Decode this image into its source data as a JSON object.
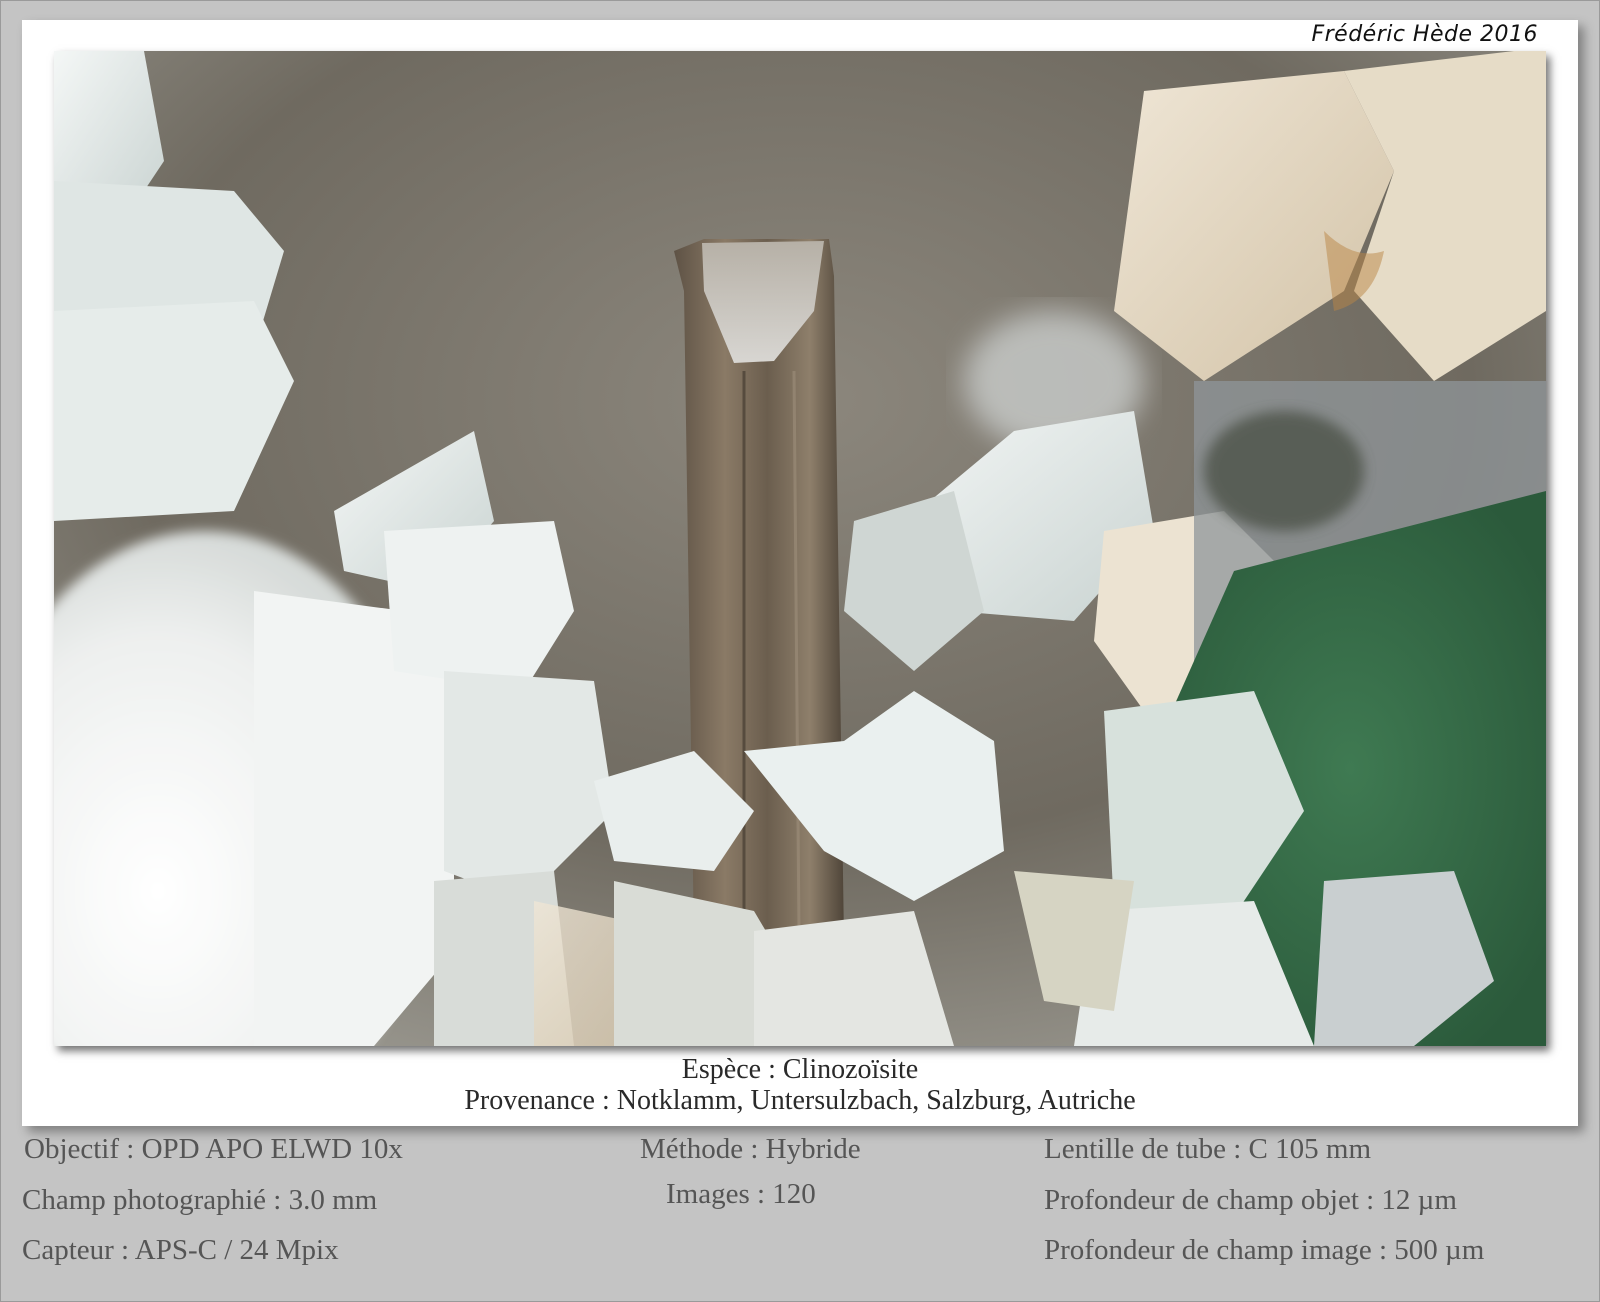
{
  "signature": "Frédéric Hède 2016",
  "caption": {
    "species": "Espèce : Clinozoïsite",
    "provenance": "Provenance : Notklamm, Untersulzbach, Salzburg, Autriche"
  },
  "details": {
    "objectif": "Objectif : OPD APO ELWD 10x",
    "champ": "Champ photographié : 3.0 mm",
    "capteur": "Capteur : APS-C / 24 Mpix",
    "methode": "Méthode : Hybride",
    "images": "Images : 120",
    "lentille": "Lentille de tube : C 105 mm",
    "profondeur_objet": "Profondeur de champ objet : 12 µm",
    "profondeur_image": "Profondeur de champ image : 500 µm"
  },
  "colors": {
    "background": "#c4c4c4",
    "card": "#ffffff",
    "caption_text": "#2a2a2a",
    "info_text": "#555555"
  }
}
